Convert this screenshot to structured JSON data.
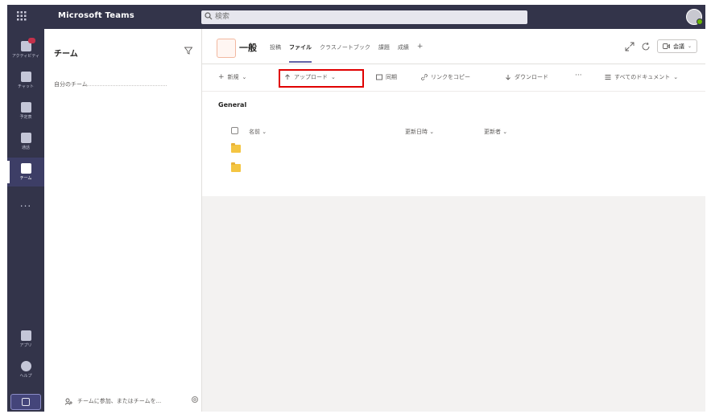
{
  "app": {
    "title": "Microsoft Teams",
    "search_placeholder": "検索"
  },
  "rail": {
    "items": [
      {
        "name": "activity",
        "label": "アクティビティ"
      },
      {
        "name": "chat",
        "label": "チャット"
      },
      {
        "name": "calendar",
        "label": "予定表"
      },
      {
        "name": "calls",
        "label": "通話"
      },
      {
        "name": "teams",
        "label": "チーム"
      }
    ],
    "more": "...",
    "bottom": [
      {
        "name": "apps",
        "label": "アプリ"
      },
      {
        "name": "help",
        "label": "ヘルプ"
      }
    ]
  },
  "teams_pane": {
    "header": "チーム",
    "section": "自分のチーム",
    "join_text": "チームに参加、またはチームを..."
  },
  "channel": {
    "name": "一般",
    "tabs": [
      "投稿",
      "ファイル",
      "クラスノートブック",
      "課題",
      "成績"
    ],
    "add_tab": "+",
    "meet_label": "会議"
  },
  "commands": {
    "new": "新規",
    "upload": "アップロード",
    "sync": "同期",
    "copy_link": "リンクをコピー",
    "download": "ダウンロード",
    "more": "···",
    "all_documents": "すべてのドキュメント"
  },
  "files": {
    "breadcrumb": "General",
    "columns": [
      "名前",
      "更新日時",
      "更新者"
    ],
    "rows": [
      {
        "name": ""
      },
      {
        "name": ""
      }
    ]
  }
}
